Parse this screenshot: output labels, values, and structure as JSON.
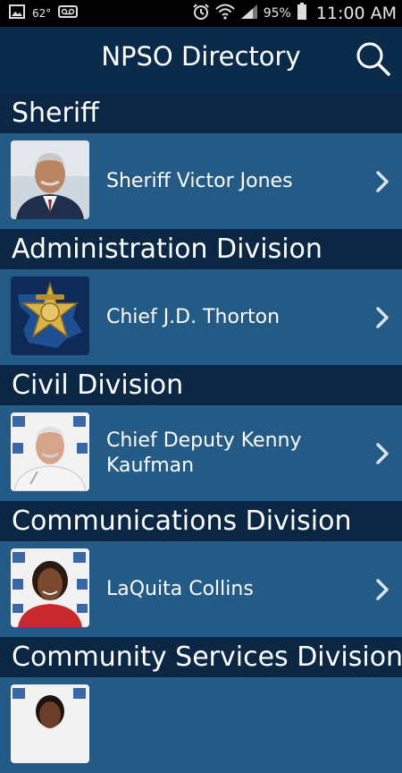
{
  "status_bar": {
    "temperature": "62°",
    "battery": "95%",
    "time": "11:00 AM"
  },
  "app_bar": {
    "title": "NPSO Directory"
  },
  "sections": [
    {
      "header": "Sheriff",
      "entries": [
        {
          "name": "Sheriff Victor Jones"
        }
      ]
    },
    {
      "header": "Administration Division",
      "entries": [
        {
          "name": "Chief J.D. Thorton"
        }
      ]
    },
    {
      "header": "Civil Division",
      "entries": [
        {
          "name": "Chief Deputy Kenny Kaufman"
        }
      ]
    },
    {
      "header": "Communications Division",
      "entries": [
        {
          "name": "LaQuita Collins"
        }
      ]
    },
    {
      "header": "Community Services Division",
      "entries": [
        {
          "name": ""
        }
      ]
    }
  ],
  "colors": {
    "header_bg": "#0b2744",
    "row_bg": "#235a86",
    "status_bg": "#000000"
  }
}
